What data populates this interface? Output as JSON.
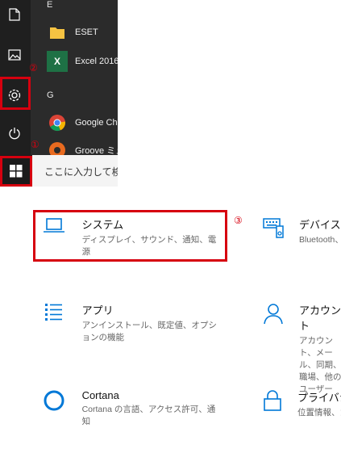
{
  "start_menu": {
    "letters": {
      "e": "E",
      "g": "G"
    },
    "apps": [
      {
        "name": "ESET",
        "icon": "folder-icon"
      },
      {
        "name": "Excel 2016",
        "icon": "excel-icon"
      },
      {
        "name": "Google Chrome",
        "icon": "chrome-icon"
      },
      {
        "name": "Groove ミュージック",
        "icon": "groove-icon"
      }
    ],
    "rail_icons": [
      "document-icon",
      "pictures-icon",
      "settings-icon",
      "power-icon"
    ]
  },
  "taskbar": {
    "search_placeholder": "ここに入力して検索"
  },
  "markers": {
    "one": "①",
    "two": "②",
    "three": "③"
  },
  "settings": {
    "tiles": [
      {
        "title": "システム",
        "desc": "ディスプレイ、サウンド、通知、電源",
        "icon": "laptop-icon"
      },
      {
        "title": "デバイス",
        "desc": "Bluetooth、プリンター、マウス",
        "icon": "devices-icon"
      },
      {
        "title": "アプリ",
        "desc": "アンインストール、既定値、オプションの機能",
        "icon": "apps-list-icon"
      },
      {
        "title": "アカウント",
        "desc": "アカウント、メール、同期、職場、他のユーザー",
        "icon": "person-icon"
      },
      {
        "title": "Cortana",
        "desc": "Cortana の言語、アクセス許可、通知",
        "icon": "cortana-icon"
      },
      {
        "title": "プライバシー",
        "desc": "位置情報、カメラ",
        "icon": "lock-icon"
      }
    ]
  },
  "colors": {
    "accent": "#0078d7",
    "annotation": "#d6000f"
  }
}
